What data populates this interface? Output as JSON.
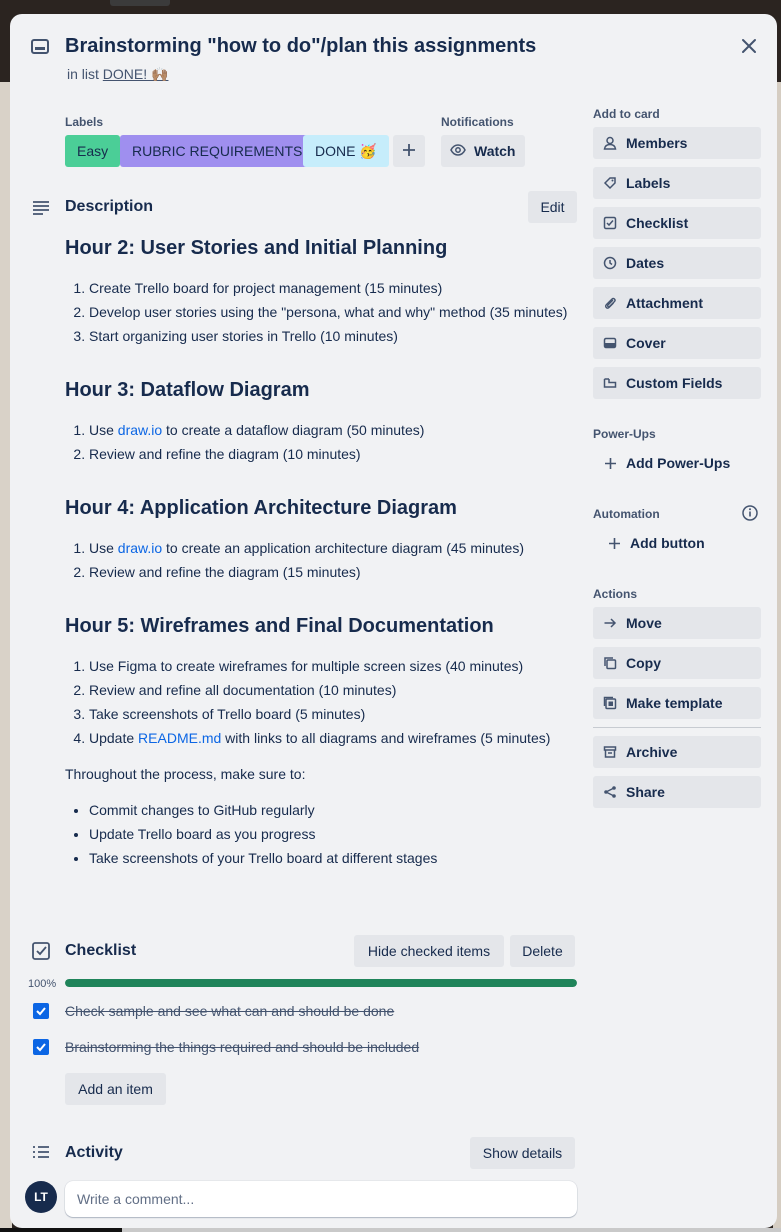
{
  "card": {
    "title": "Brainstorming \"how to do\"/plan this assignments",
    "in_list_prefix": "in list",
    "list_name": "DONE! 🙌🏽"
  },
  "labels": {
    "heading": "Labels",
    "items": [
      {
        "text": "Easy",
        "color": "#4bce97"
      },
      {
        "text": "RUBRIC REQUIREMENTS",
        "color": "#9f8fef"
      },
      {
        "text": "DONE 🥳",
        "color": "#c6edfb"
      }
    ]
  },
  "notifications": {
    "heading": "Notifications",
    "watch_label": "Watch"
  },
  "description": {
    "heading": "Description",
    "edit_label": "Edit",
    "hour2": {
      "title": "Hour 2: User Stories and Initial Planning",
      "items": [
        "Create Trello board for project management (15 minutes)",
        "Develop user stories using the \"persona, what and why\" method (35 minutes)",
        "Start organizing user stories in Trello (10 minutes)"
      ]
    },
    "hour3": {
      "title": "Hour 3: Dataflow Diagram",
      "item1_pre": "Use ",
      "item1_link": "draw.io",
      "item1_post": " to create a dataflow diagram (50 minutes)",
      "item2": "Review and refine the diagram (10 minutes)"
    },
    "hour4": {
      "title": "Hour 4: Application Architecture Diagram",
      "item1_pre": "Use ",
      "item1_link": "draw.io",
      "item1_post": " to create an application architecture diagram (45 minutes)",
      "item2": "Review and refine the diagram (15 minutes)"
    },
    "hour5": {
      "title": "Hour 5: Wireframes and Final Documentation",
      "item1": "Use Figma to create wireframes for multiple screen sizes (40 minutes)",
      "item2": "Review and refine all documentation (10 minutes)",
      "item3": "Take screenshots of Trello board (5 minutes)",
      "item4_pre": "Update ",
      "item4_link": "README.md",
      "item4_post": " with links to all diagrams and wireframes (5 minutes)"
    },
    "throughout": "Throughout the process, make sure to:",
    "bullets": [
      "Commit changes to GitHub regularly",
      "Update Trello board as you progress",
      "Take screenshots of your Trello board at different stages"
    ]
  },
  "checklist": {
    "heading": "Checklist",
    "hide_label": "Hide checked items",
    "delete_label": "Delete",
    "progress_text": "100%",
    "progress_fraction": 1.0,
    "items": [
      {
        "text": "Check sample and see what can and should be done",
        "checked": true
      },
      {
        "text": "Brainstorming the things required and should be included",
        "checked": true
      }
    ],
    "add_item_label": "Add an item"
  },
  "activity": {
    "heading": "Activity",
    "show_details_label": "Show details",
    "avatar_initials": "LT",
    "comment_placeholder": "Write a comment..."
  },
  "sidebar": {
    "add_to_card": {
      "heading": "Add to card",
      "items": [
        "Members",
        "Labels",
        "Checklist",
        "Dates",
        "Attachment",
        "Cover",
        "Custom Fields"
      ]
    },
    "power_ups": {
      "heading": "Power-Ups",
      "add_label": "Add Power-Ups"
    },
    "automation": {
      "heading": "Automation",
      "add_label": "Add button"
    },
    "actions": {
      "heading": "Actions",
      "items": [
        "Move",
        "Copy",
        "Make template"
      ],
      "items2": [
        "Archive",
        "Share"
      ]
    }
  },
  "colors": {
    "accent_blue": "#0c66e4",
    "progress_green": "#1f845a",
    "modal_bg": "#f1f2f4",
    "button_bg": "#e4e6ea"
  }
}
